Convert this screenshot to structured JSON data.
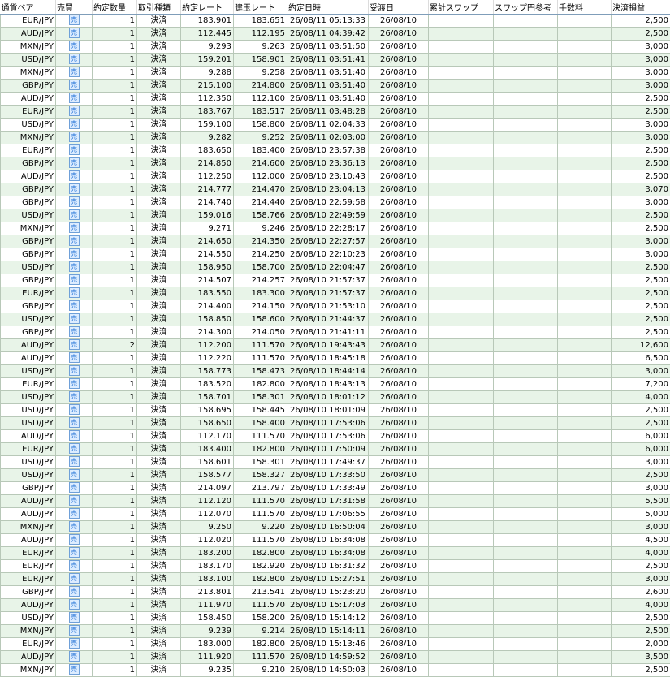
{
  "headers": [
    "通貨ペア",
    "売買",
    "約定数量",
    "取引種類",
    "約定レート",
    "建玉レート",
    "約定日時",
    "受渡日",
    "累計スワップ",
    "スワップ円参考",
    "手数料",
    "決済損益"
  ],
  "rows": [
    [
      "EUR/JPY",
      "売",
      "1",
      "決済",
      "183.901",
      "183.651",
      "26/08/11 05:13:33",
      "26/08/10",
      "",
      "",
      "",
      "2,500"
    ],
    [
      "AUD/JPY",
      "売",
      "1",
      "決済",
      "112.445",
      "112.195",
      "26/08/11 04:39:42",
      "26/08/10",
      "",
      "",
      "",
      "2,500"
    ],
    [
      "MXN/JPY",
      "売",
      "1",
      "決済",
      "9.293",
      "9.263",
      "26/08/11 03:51:50",
      "26/08/10",
      "",
      "",
      "",
      "3,000"
    ],
    [
      "USD/JPY",
      "売",
      "1",
      "決済",
      "159.201",
      "158.901",
      "26/08/11 03:51:41",
      "26/08/10",
      "",
      "",
      "",
      "3,000"
    ],
    [
      "MXN/JPY",
      "売",
      "1",
      "決済",
      "9.288",
      "9.258",
      "26/08/11 03:51:40",
      "26/08/10",
      "",
      "",
      "",
      "3,000"
    ],
    [
      "GBP/JPY",
      "売",
      "1",
      "決済",
      "215.100",
      "214.800",
      "26/08/11 03:51:40",
      "26/08/10",
      "",
      "",
      "",
      "3,000"
    ],
    [
      "AUD/JPY",
      "売",
      "1",
      "決済",
      "112.350",
      "112.100",
      "26/08/11 03:51:40",
      "26/08/10",
      "",
      "",
      "",
      "2,500"
    ],
    [
      "EUR/JPY",
      "売",
      "1",
      "決済",
      "183.767",
      "183.517",
      "26/08/11 03:48:28",
      "26/08/10",
      "",
      "",
      "",
      "2,500"
    ],
    [
      "USD/JPY",
      "売",
      "1",
      "決済",
      "159.100",
      "158.800",
      "26/08/11 02:04:33",
      "26/08/10",
      "",
      "",
      "",
      "3,000"
    ],
    [
      "MXN/JPY",
      "売",
      "1",
      "決済",
      "9.282",
      "9.252",
      "26/08/11 02:03:00",
      "26/08/10",
      "",
      "",
      "",
      "3,000"
    ],
    [
      "EUR/JPY",
      "売",
      "1",
      "決済",
      "183.650",
      "183.400",
      "26/08/10 23:57:38",
      "26/08/10",
      "",
      "",
      "",
      "2,500"
    ],
    [
      "GBP/JPY",
      "売",
      "1",
      "決済",
      "214.850",
      "214.600",
      "26/08/10 23:36:13",
      "26/08/10",
      "",
      "",
      "",
      "2,500"
    ],
    [
      "AUD/JPY",
      "売",
      "1",
      "決済",
      "112.250",
      "112.000",
      "26/08/10 23:10:43",
      "26/08/10",
      "",
      "",
      "",
      "2,500"
    ],
    [
      "GBP/JPY",
      "売",
      "1",
      "決済",
      "214.777",
      "214.470",
      "26/08/10 23:04:13",
      "26/08/10",
      "",
      "",
      "",
      "3,070"
    ],
    [
      "GBP/JPY",
      "売",
      "1",
      "決済",
      "214.740",
      "214.440",
      "26/08/10 22:59:58",
      "26/08/10",
      "",
      "",
      "",
      "3,000"
    ],
    [
      "USD/JPY",
      "売",
      "1",
      "決済",
      "159.016",
      "158.766",
      "26/08/10 22:49:59",
      "26/08/10",
      "",
      "",
      "",
      "2,500"
    ],
    [
      "MXN/JPY",
      "売",
      "1",
      "決済",
      "9.271",
      "9.246",
      "26/08/10 22:28:17",
      "26/08/10",
      "",
      "",
      "",
      "2,500"
    ],
    [
      "GBP/JPY",
      "売",
      "1",
      "決済",
      "214.650",
      "214.350",
      "26/08/10 22:27:57",
      "26/08/10",
      "",
      "",
      "",
      "3,000"
    ],
    [
      "GBP/JPY",
      "売",
      "1",
      "決済",
      "214.550",
      "214.250",
      "26/08/10 22:10:23",
      "26/08/10",
      "",
      "",
      "",
      "3,000"
    ],
    [
      "USD/JPY",
      "売",
      "1",
      "決済",
      "158.950",
      "158.700",
      "26/08/10 22:04:47",
      "26/08/10",
      "",
      "",
      "",
      "2,500"
    ],
    [
      "GBP/JPY",
      "売",
      "1",
      "決済",
      "214.507",
      "214.257",
      "26/08/10 21:57:37",
      "26/08/10",
      "",
      "",
      "",
      "2,500"
    ],
    [
      "EUR/JPY",
      "売",
      "1",
      "決済",
      "183.550",
      "183.300",
      "26/08/10 21:57:37",
      "26/08/10",
      "",
      "",
      "",
      "2,500"
    ],
    [
      "GBP/JPY",
      "売",
      "1",
      "決済",
      "214.400",
      "214.150",
      "26/08/10 21:53:10",
      "26/08/10",
      "",
      "",
      "",
      "2,500"
    ],
    [
      "USD/JPY",
      "売",
      "1",
      "決済",
      "158.850",
      "158.600",
      "26/08/10 21:44:37",
      "26/08/10",
      "",
      "",
      "",
      "2,500"
    ],
    [
      "GBP/JPY",
      "売",
      "1",
      "決済",
      "214.300",
      "214.050",
      "26/08/10 21:41:11",
      "26/08/10",
      "",
      "",
      "",
      "2,500"
    ],
    [
      "AUD/JPY",
      "売",
      "2",
      "決済",
      "112.200",
      "111.570",
      "26/08/10 19:43:43",
      "26/08/10",
      "",
      "",
      "",
      "12,600"
    ],
    [
      "AUD/JPY",
      "売",
      "1",
      "決済",
      "112.220",
      "111.570",
      "26/08/10 18:45:18",
      "26/08/10",
      "",
      "",
      "",
      "6,500"
    ],
    [
      "USD/JPY",
      "売",
      "1",
      "決済",
      "158.773",
      "158.473",
      "26/08/10 18:44:14",
      "26/08/10",
      "",
      "",
      "",
      "3,000"
    ],
    [
      "EUR/JPY",
      "売",
      "1",
      "決済",
      "183.520",
      "182.800",
      "26/08/10 18:43:13",
      "26/08/10",
      "",
      "",
      "",
      "7,200"
    ],
    [
      "USD/JPY",
      "売",
      "1",
      "決済",
      "158.701",
      "158.301",
      "26/08/10 18:01:12",
      "26/08/10",
      "",
      "",
      "",
      "4,000"
    ],
    [
      "USD/JPY",
      "売",
      "1",
      "決済",
      "158.695",
      "158.445",
      "26/08/10 18:01:09",
      "26/08/10",
      "",
      "",
      "",
      "2,500"
    ],
    [
      "USD/JPY",
      "売",
      "1",
      "決済",
      "158.650",
      "158.400",
      "26/08/10 17:53:06",
      "26/08/10",
      "",
      "",
      "",
      "2,500"
    ],
    [
      "AUD/JPY",
      "売",
      "1",
      "決済",
      "112.170",
      "111.570",
      "26/08/10 17:53:06",
      "26/08/10",
      "",
      "",
      "",
      "6,000"
    ],
    [
      "EUR/JPY",
      "売",
      "1",
      "決済",
      "183.400",
      "182.800",
      "26/08/10 17:50:09",
      "26/08/10",
      "",
      "",
      "",
      "6,000"
    ],
    [
      "USD/JPY",
      "売",
      "1",
      "決済",
      "158.601",
      "158.301",
      "26/08/10 17:49:37",
      "26/08/10",
      "",
      "",
      "",
      "3,000"
    ],
    [
      "USD/JPY",
      "売",
      "1",
      "決済",
      "158.577",
      "158.327",
      "26/08/10 17:33:50",
      "26/08/10",
      "",
      "",
      "",
      "2,500"
    ],
    [
      "GBP/JPY",
      "売",
      "1",
      "決済",
      "214.097",
      "213.797",
      "26/08/10 17:33:49",
      "26/08/10",
      "",
      "",
      "",
      "3,000"
    ],
    [
      "AUD/JPY",
      "売",
      "1",
      "決済",
      "112.120",
      "111.570",
      "26/08/10 17:31:58",
      "26/08/10",
      "",
      "",
      "",
      "5,500"
    ],
    [
      "AUD/JPY",
      "売",
      "1",
      "決済",
      "112.070",
      "111.570",
      "26/08/10 17:06:55",
      "26/08/10",
      "",
      "",
      "",
      "5,000"
    ],
    [
      "MXN/JPY",
      "売",
      "1",
      "決済",
      "9.250",
      "9.220",
      "26/08/10 16:50:04",
      "26/08/10",
      "",
      "",
      "",
      "3,000"
    ],
    [
      "AUD/JPY",
      "売",
      "1",
      "決済",
      "112.020",
      "111.570",
      "26/08/10 16:34:08",
      "26/08/10",
      "",
      "",
      "",
      "4,500"
    ],
    [
      "EUR/JPY",
      "売",
      "1",
      "決済",
      "183.200",
      "182.800",
      "26/08/10 16:34:08",
      "26/08/10",
      "",
      "",
      "",
      "4,000"
    ],
    [
      "EUR/JPY",
      "売",
      "1",
      "決済",
      "183.170",
      "182.920",
      "26/08/10 16:31:32",
      "26/08/10",
      "",
      "",
      "",
      "2,500"
    ],
    [
      "EUR/JPY",
      "売",
      "1",
      "決済",
      "183.100",
      "182.800",
      "26/08/10 15:27:51",
      "26/08/10",
      "",
      "",
      "",
      "3,000"
    ],
    [
      "GBP/JPY",
      "売",
      "1",
      "決済",
      "213.801",
      "213.541",
      "26/08/10 15:23:20",
      "26/08/10",
      "",
      "",
      "",
      "2,600"
    ],
    [
      "AUD/JPY",
      "売",
      "1",
      "決済",
      "111.970",
      "111.570",
      "26/08/10 15:17:03",
      "26/08/10",
      "",
      "",
      "",
      "4,000"
    ],
    [
      "USD/JPY",
      "売",
      "1",
      "決済",
      "158.450",
      "158.200",
      "26/08/10 15:14:12",
      "26/08/10",
      "",
      "",
      "",
      "2,500"
    ],
    [
      "MXN/JPY",
      "売",
      "1",
      "決済",
      "9.239",
      "9.214",
      "26/08/10 15:14:11",
      "26/08/10",
      "",
      "",
      "",
      "2,500"
    ],
    [
      "EUR/JPY",
      "売",
      "1",
      "決済",
      "183.000",
      "182.800",
      "26/08/10 15:13:46",
      "26/08/10",
      "",
      "",
      "",
      "2,000"
    ],
    [
      "AUD/JPY",
      "売",
      "1",
      "決済",
      "111.920",
      "111.570",
      "26/08/10 14:59:52",
      "26/08/10",
      "",
      "",
      "",
      "3,500"
    ],
    [
      "MXN/JPY",
      "売",
      "1",
      "決済",
      "9.235",
      "9.210",
      "26/08/10 14:50:03",
      "26/08/10",
      "",
      "",
      "",
      "2,500"
    ]
  ]
}
